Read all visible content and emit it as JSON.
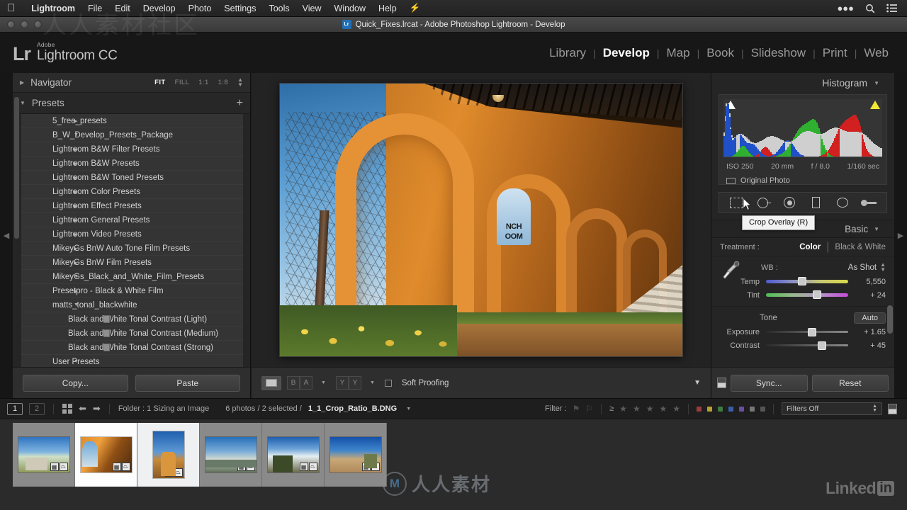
{
  "menubar": {
    "apple_icon": "apple-icon",
    "items": [
      {
        "label": "Lightroom",
        "bold": true
      },
      {
        "label": "File",
        "bold": false
      },
      {
        "label": "Edit",
        "bold": false
      },
      {
        "label": "Develop",
        "bold": false
      },
      {
        "label": "Photo",
        "bold": false
      },
      {
        "label": "Settings",
        "bold": false
      },
      {
        "label": "Tools",
        "bold": false
      },
      {
        "label": "View",
        "bold": false
      },
      {
        "label": "Window",
        "bold": false
      },
      {
        "label": "Help",
        "bold": false
      }
    ],
    "right_icons": [
      "bolt-icon",
      "ellipsis-icon",
      "search-icon",
      "list-icon"
    ]
  },
  "titlebar": {
    "title": "Quick_Fixes.lrcat - Adobe Photoshop Lightroom - Develop",
    "app_badge": "Lr"
  },
  "header": {
    "brand_mark": "Lr",
    "brand_adobe": "Adobe",
    "brand_name": "Lightroom CC",
    "modules": [
      {
        "label": "Library",
        "active": false
      },
      {
        "label": "Develop",
        "active": true
      },
      {
        "label": "Map",
        "active": false
      },
      {
        "label": "Book",
        "active": false
      },
      {
        "label": "Slideshow",
        "active": false
      },
      {
        "label": "Print",
        "active": false
      },
      {
        "label": "Web",
        "active": false
      }
    ]
  },
  "left_panel": {
    "navigator": {
      "title": "Navigator",
      "zoom_levels": [
        {
          "label": "FIT",
          "active": true
        },
        {
          "label": "FILL",
          "active": false
        },
        {
          "label": "1:1",
          "active": false
        },
        {
          "label": "1:8",
          "active": false
        }
      ]
    },
    "presets": {
      "title": "Presets",
      "add_label": "+",
      "items": [
        {
          "label": "5_free_presets",
          "expanded": false,
          "child": false
        },
        {
          "label": "B_W_Develop_Presets_Package",
          "expanded": true,
          "child": false
        },
        {
          "label": "Lightroom B&W Filter Presets",
          "expanded": false,
          "child": false
        },
        {
          "label": "Lightroom B&W Presets",
          "expanded": false,
          "child": false
        },
        {
          "label": "Lightroom B&W Toned Presets",
          "expanded": false,
          "child": false
        },
        {
          "label": "Lightroom Color Presets",
          "expanded": false,
          "child": false
        },
        {
          "label": "Lightroom Effect Presets",
          "expanded": false,
          "child": false
        },
        {
          "label": "Lightroom General Presets",
          "expanded": false,
          "child": false
        },
        {
          "label": "Lightroom Video Presets",
          "expanded": false,
          "child": false
        },
        {
          "label": "MikeyGs BnW Auto Tone Film Presets",
          "expanded": false,
          "child": false
        },
        {
          "label": "MikeyGs BnW Film Presets",
          "expanded": false,
          "child": false
        },
        {
          "label": "MikeyGs_Black_and_White_Film_Presets",
          "expanded": true,
          "child": false
        },
        {
          "label": "Presetpro - Black & White Film",
          "expanded": false,
          "child": false
        },
        {
          "label": "matts_tonal_blackwhite",
          "expanded": true,
          "child": false
        },
        {
          "label": "Black and White Tonal Contrast (Light)",
          "expanded": false,
          "child": true
        },
        {
          "label": "Black and White Tonal Contrast (Medium)",
          "expanded": false,
          "child": true
        },
        {
          "label": "Black and White Tonal Contrast (Strong)",
          "expanded": false,
          "child": true
        },
        {
          "label": "User Presets",
          "expanded": true,
          "child": false
        }
      ]
    },
    "buttons": {
      "copy": "Copy...",
      "paste": "Paste"
    }
  },
  "center": {
    "toolbar": {
      "soft_proofing_label": "Soft Proofing",
      "soft_proofing_checked": false,
      "view_mode": "loupe-view",
      "before_after_label": "BA",
      "flag_label": "YY"
    }
  },
  "right_panel": {
    "histogram": {
      "title": "Histogram",
      "exif": {
        "iso": "ISO 250",
        "focal": "20 mm",
        "aperture": "f / 8.0",
        "shutter": "1/160 sec"
      },
      "original_photo_label": "Original Photo",
      "shadow_clip_color": "#ffffff",
      "highlight_clip_color": "#f2e733"
    },
    "tools": [
      {
        "name": "crop-overlay-tool",
        "active": true
      },
      {
        "name": "spot-removal-tool",
        "active": false
      },
      {
        "name": "red-eye-tool",
        "active": false
      },
      {
        "name": "graduated-filter-tool",
        "active": false
      },
      {
        "name": "radial-filter-tool",
        "active": false
      },
      {
        "name": "adjustment-brush-tool",
        "active": false
      }
    ],
    "tooltip": "Crop Overlay (R)",
    "basic": {
      "title": "Basic",
      "treatment_label": "Treatment :",
      "treatment_options": [
        {
          "label": "Color",
          "active": true
        },
        {
          "label": "Black & White",
          "active": false
        }
      ],
      "wb_label": "WB :",
      "wb_value": "As Shot",
      "white_balance": [
        {
          "name": "Temp",
          "value": "5,550",
          "pos": 44,
          "type": "temp"
        },
        {
          "name": "Tint",
          "value": "+ 24",
          "pos": 62,
          "type": "tint"
        }
      ],
      "tone_label": "Tone",
      "auto_label": "Auto",
      "tone_sliders": [
        {
          "name": "Exposure",
          "value": "+ 1.65",
          "pos": 56
        },
        {
          "name": "Contrast",
          "value": "+ 45",
          "pos": 68
        }
      ]
    },
    "buttons": {
      "sync": "Sync...",
      "reset": "Reset"
    }
  },
  "filmstrip_bar": {
    "screens": [
      {
        "label": "1",
        "active": true
      },
      {
        "label": "2",
        "active": false
      }
    ],
    "folder_label": "Folder : 1 Sizing an Image",
    "photo_count": "6 photos / 2 selected / ",
    "current_file": "1_1_Crop_Ratio_B.DNG",
    "filter_label": "Filter :",
    "filters_value": "Filters Off",
    "star_count": 5,
    "color_swatches": [
      "#9b3b3b",
      "#b8a030",
      "#3f7a3f",
      "#3a5fa8",
      "#6a4fa0",
      "#777777",
      "#555555"
    ]
  },
  "filmstrip": {
    "thumbnails": [
      {
        "name": "thumb-adobe-building",
        "style": "t1",
        "state": "normal",
        "orientation": "landscape"
      },
      {
        "name": "thumb-arcade-portico",
        "style": "t2",
        "state": "sel",
        "orientation": "landscape"
      },
      {
        "name": "thumb-mission-church",
        "style": "t3",
        "state": "active",
        "orientation": "portrait"
      },
      {
        "name": "thumb-mountain-vista",
        "style": "t4",
        "state": "normal",
        "orientation": "landscape"
      },
      {
        "name": "thumb-desert-yucca",
        "style": "t5",
        "state": "normal",
        "orientation": "landscape"
      },
      {
        "name": "thumb-desert-dunes",
        "style": "t6",
        "state": "normal",
        "orientation": "landscape"
      }
    ]
  },
  "watermarks": {
    "center_text": "人人素材",
    "center_mark": "M",
    "linkedin_text": "Linked",
    "linkedin_in": "in",
    "topleft_text": "人人素材社区"
  }
}
